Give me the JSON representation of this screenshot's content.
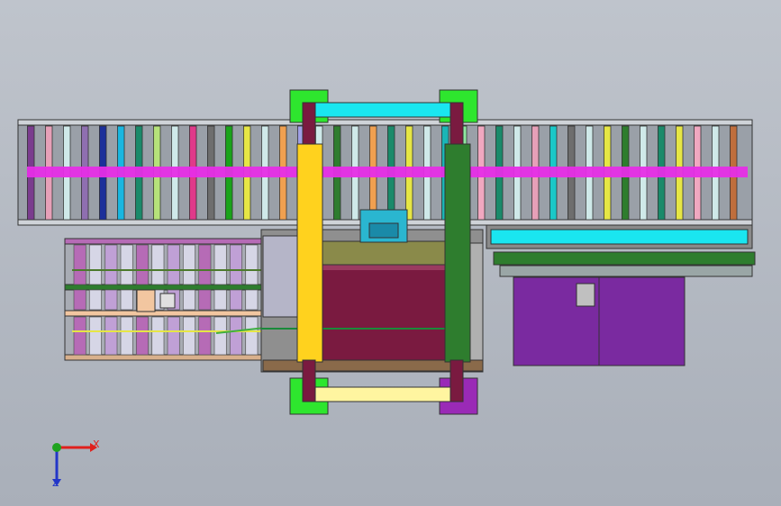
{
  "viewport": {
    "background_top": "#bfc4cc",
    "background_bottom": "#a9afb9"
  },
  "triad": {
    "x_label": "X",
    "z_label": "Z",
    "x_color": "#e0201c",
    "y_color": "#1ea31e",
    "z_color": "#2236c8"
  },
  "colors": {
    "top_rollers": [
      "#7a3c8e",
      "#e6a0b8",
      "#cfe9e9",
      "#8f6fb0",
      "#1c2f9a",
      "#19b6e0",
      "#1a8a6a",
      "#b6e27a",
      "#cfe9e9",
      "#e03a8a",
      "#6e6e6e",
      "#1aa31a",
      "#e6e645",
      "#cfe9e9",
      "#f0a050",
      "#a0a0e6",
      "#cfe9e9",
      "#2e7d2e",
      "#cfe9e9",
      "#f0a050",
      "#1a8a6a",
      "#e6e645",
      "#cfe9e9",
      "#1ab6b6",
      "#8fe8a0",
      "#f0a8c0",
      "#1a8a6a",
      "#cfe9e9",
      "#e6a0b8",
      "#1ac8c8",
      "#6e6e6e",
      "#cfe9e9",
      "#e6e645",
      "#2e7d2e",
      "#cfe9e9",
      "#1a8a6a",
      "#e6e645",
      "#f0a8c0",
      "#cfe9e9",
      "#c06e3c"
    ],
    "magenta_bar": "#e62ee6",
    "yellow_beam": "#ffd21e",
    "green_beam": "#2e7d2e",
    "maroon": "#7a1a40",
    "cyan_top": "#1ae6f0",
    "purple_box": "#7a2aa0",
    "light_yellow": "#fff5a0",
    "olive": "#8a8a4a"
  }
}
